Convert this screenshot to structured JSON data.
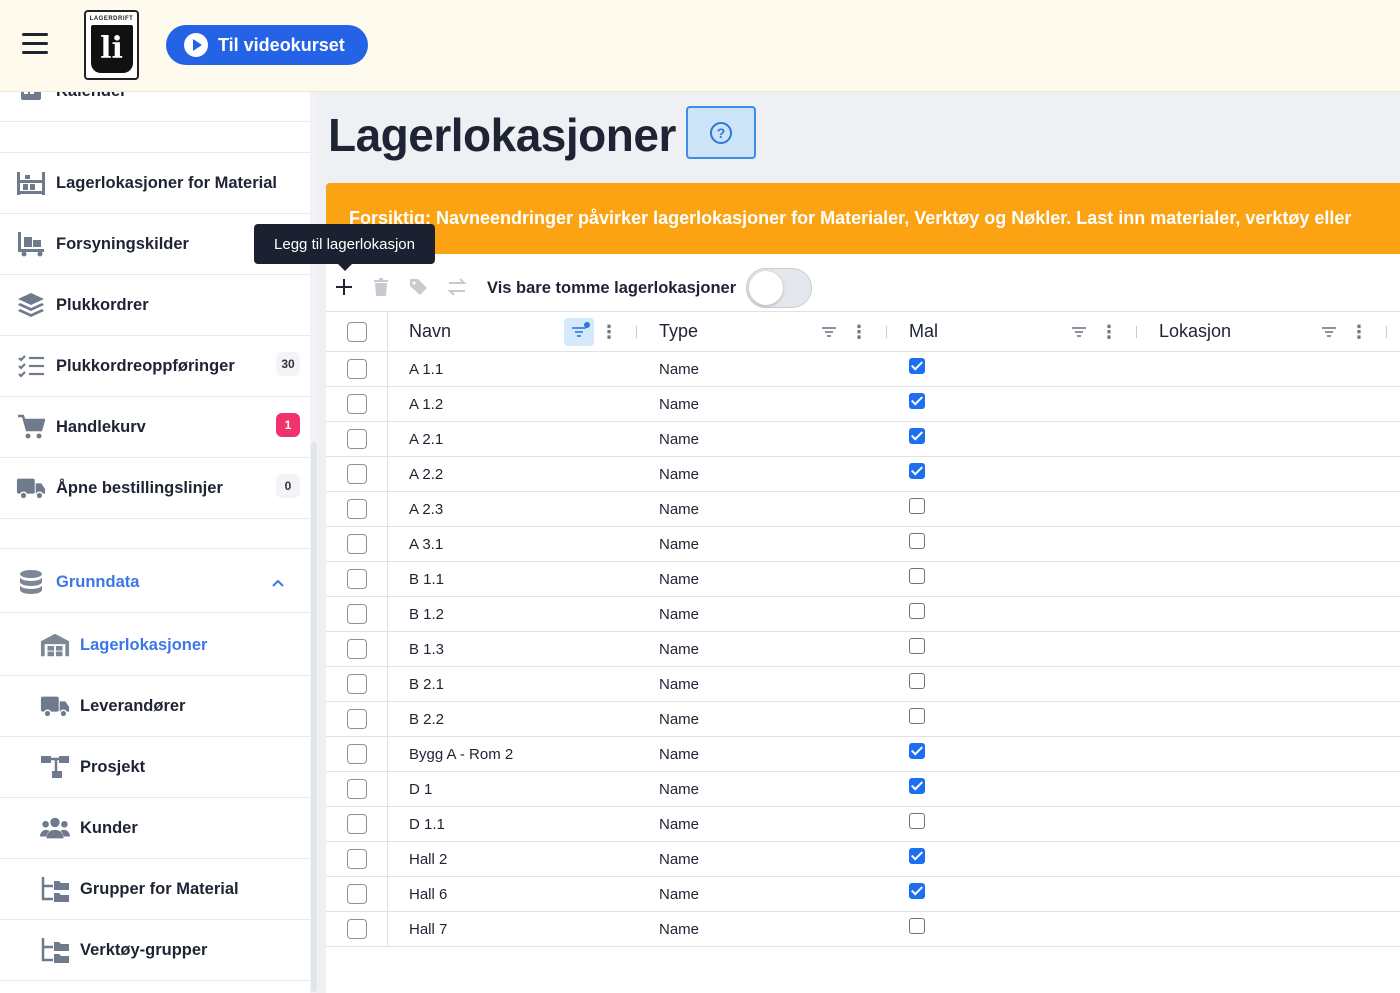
{
  "header": {
    "video_button": "Til videokurset",
    "logo_text": "LAGERDRIFT"
  },
  "sidebar": {
    "partial_item": "Kalender",
    "items": [
      {
        "label": "Lagerlokasjoner for Material",
        "icon": "warehouse-icon",
        "badge": null
      },
      {
        "label": "Forsyningskilder",
        "icon": "forklift-icon",
        "badge": null
      },
      {
        "label": "Plukkordrer",
        "icon": "layers-icon",
        "badge": null
      },
      {
        "label": "Plukkordreoppføringer",
        "icon": "checklist-icon",
        "badge": "30"
      },
      {
        "label": "Handlekurv",
        "icon": "cart-icon",
        "badge": "1"
      },
      {
        "label": "Åpne bestillingslinjer",
        "icon": "truck-icon",
        "badge": "0"
      }
    ],
    "group": {
      "label": "Grunndata",
      "icon": "database-icon",
      "expanded": true
    },
    "sub_items": [
      {
        "label": "Lagerlokasjoner",
        "icon": "warehouse-icon",
        "active": true
      },
      {
        "label": "Leverandører",
        "icon": "truck-icon",
        "active": false
      },
      {
        "label": "Prosjekt",
        "icon": "project-tree-icon",
        "active": false
      },
      {
        "label": "Kunder",
        "icon": "users-icon",
        "active": false
      },
      {
        "label": "Grupper for Material",
        "icon": "folder-tree-icon",
        "active": false
      },
      {
        "label": "Verktøy-grupper",
        "icon": "folder-tree-icon",
        "active": false
      }
    ]
  },
  "page": {
    "title": "Lagerlokasjoner",
    "warning": "Forsiktig: Navneendringer påvirker lagerlokasjoner for Materialer, Verktøy og Nøkler. Last inn materialer, verktøy eller"
  },
  "toolbar": {
    "add_tooltip": "Legg til lagerlokasjon",
    "toggle_label": "Vis bare tomme lagerlokasjoner",
    "toggle_on": false
  },
  "table": {
    "columns": [
      "Navn",
      "Type",
      "Mal",
      "Lokasjon"
    ],
    "rows": [
      {
        "navn": "A 1.1",
        "type": "Name",
        "mal": true
      },
      {
        "navn": "A 1.2",
        "type": "Name",
        "mal": true
      },
      {
        "navn": "A 2.1",
        "type": "Name",
        "mal": true
      },
      {
        "navn": "A 2.2",
        "type": "Name",
        "mal": true
      },
      {
        "navn": "A 2.3",
        "type": "Name",
        "mal": false
      },
      {
        "navn": "A 3.1",
        "type": "Name",
        "mal": false
      },
      {
        "navn": "B 1.1",
        "type": "Name",
        "mal": false
      },
      {
        "navn": "B 1.2",
        "type": "Name",
        "mal": false
      },
      {
        "navn": "B 1.3",
        "type": "Name",
        "mal": false
      },
      {
        "navn": "B 2.1",
        "type": "Name",
        "mal": false
      },
      {
        "navn": "B 2.2",
        "type": "Name",
        "mal": false
      },
      {
        "navn": "Bygg A - Rom 2",
        "type": "Name",
        "mal": true
      },
      {
        "navn": "D 1",
        "type": "Name",
        "mal": true
      },
      {
        "navn": "D 1.1",
        "type": "Name",
        "mal": false
      },
      {
        "navn": "Hall 2",
        "type": "Name",
        "mal": true
      },
      {
        "navn": "Hall 6",
        "type": "Name",
        "mal": true
      },
      {
        "navn": "Hall 7",
        "type": "Name",
        "mal": false
      }
    ]
  },
  "colors": {
    "accent": "#3b78e6",
    "primary_button": "#2462e6",
    "warning": "#fba313",
    "badge_red": "#f0336b",
    "header_bg": "#fffaee"
  }
}
